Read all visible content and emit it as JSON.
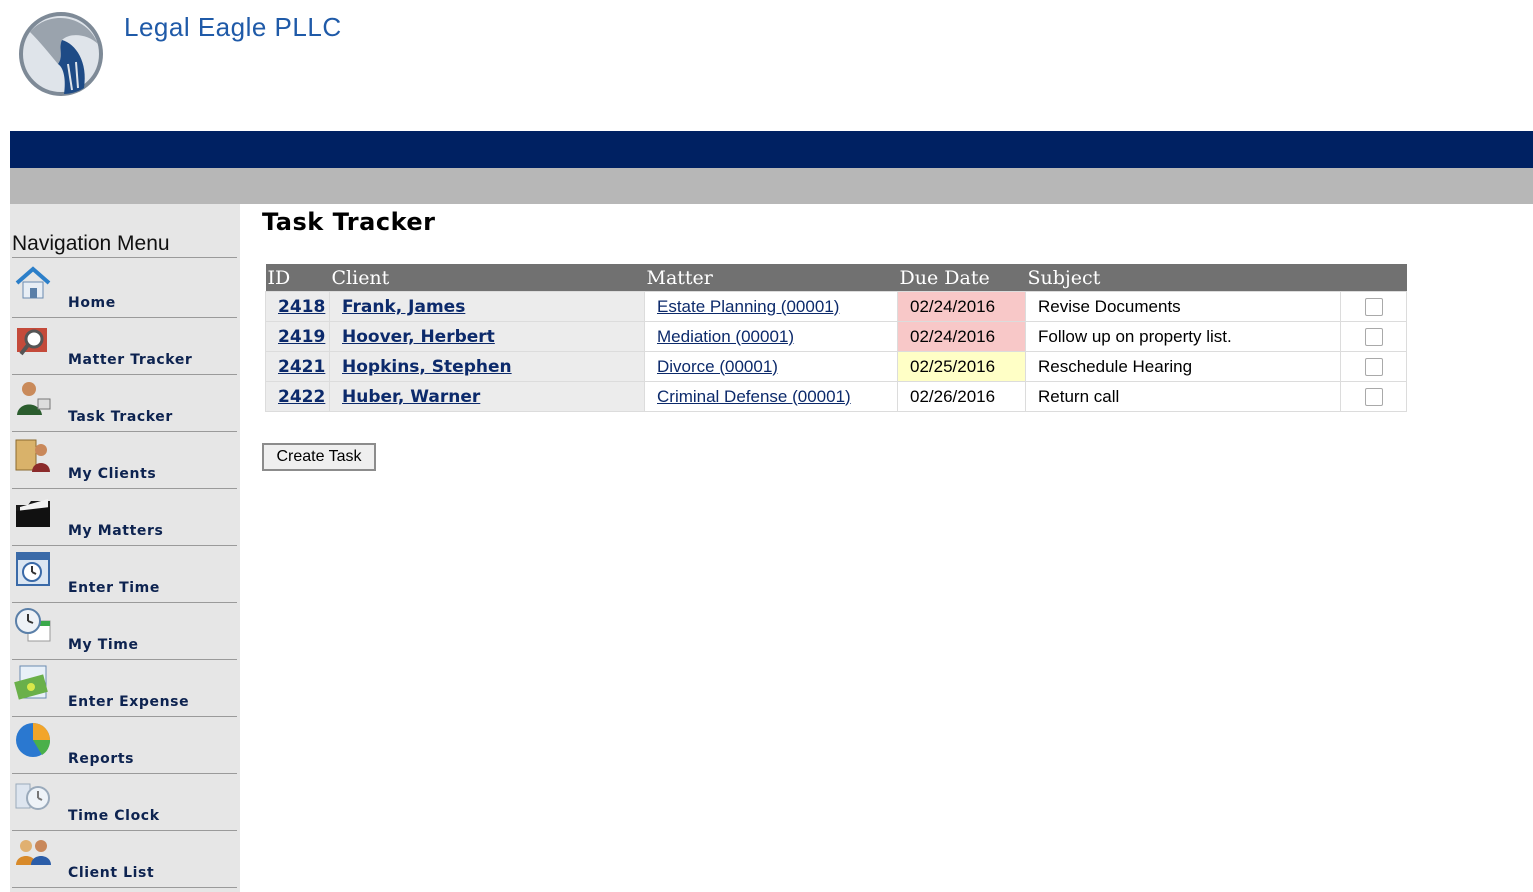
{
  "header": {
    "company_name": "Legal Eagle PLLC",
    "logo_icon": "eagle-logo-icon"
  },
  "colors": {
    "navy_bar": "#002162",
    "gray_bar": "#b7b7b7",
    "due_overdue": "#f8c8c8",
    "due_soon": "#ffffc6"
  },
  "sidebar": {
    "title": "Navigation Menu",
    "items": [
      {
        "label": "Home",
        "icon": "home-icon"
      },
      {
        "label": "Matter Tracker",
        "icon": "magnifier-folder-icon"
      },
      {
        "label": "Task Tracker",
        "icon": "businessman-icon"
      },
      {
        "label": "My Clients",
        "icon": "clients-folder-icon"
      },
      {
        "label": "My Matters",
        "icon": "open-folder-icon"
      },
      {
        "label": "Enter Time",
        "icon": "clock-calendar-icon"
      },
      {
        "label": "My Time",
        "icon": "clock-calendar-green-icon"
      },
      {
        "label": "Enter Expense",
        "icon": "money-notepad-icon"
      },
      {
        "label": "Reports",
        "icon": "pie-chart-icon"
      },
      {
        "label": "Time Clock",
        "icon": "time-clock-icon"
      },
      {
        "label": "Client List",
        "icon": "people-icon"
      }
    ]
  },
  "main": {
    "title": "Task Tracker",
    "table": {
      "headers": [
        "ID",
        "Client",
        "Matter",
        "Due Date",
        "Subject",
        ""
      ],
      "rows": [
        {
          "id": "2418",
          "client": "Frank, James",
          "matter": "Estate Planning (00001)",
          "due_date": "02/24/2016",
          "due_status": "overdue",
          "subject": "Revise Documents"
        },
        {
          "id": "2419",
          "client": "Hoover, Herbert",
          "matter": "Mediation (00001)",
          "due_date": "02/24/2016",
          "due_status": "overdue",
          "subject": "Follow up on property list."
        },
        {
          "id": "2421",
          "client": "Hopkins, Stephen",
          "matter": "Divorce (00001)",
          "due_date": "02/25/2016",
          "due_status": "soon",
          "subject": "Reschedule Hearing"
        },
        {
          "id": "2422",
          "client": "Huber, Warner",
          "matter": "Criminal Defense (00001)",
          "due_date": "02/26/2016",
          "due_status": "normal",
          "subject": "Return call"
        }
      ]
    },
    "create_task_label": "Create Task"
  }
}
